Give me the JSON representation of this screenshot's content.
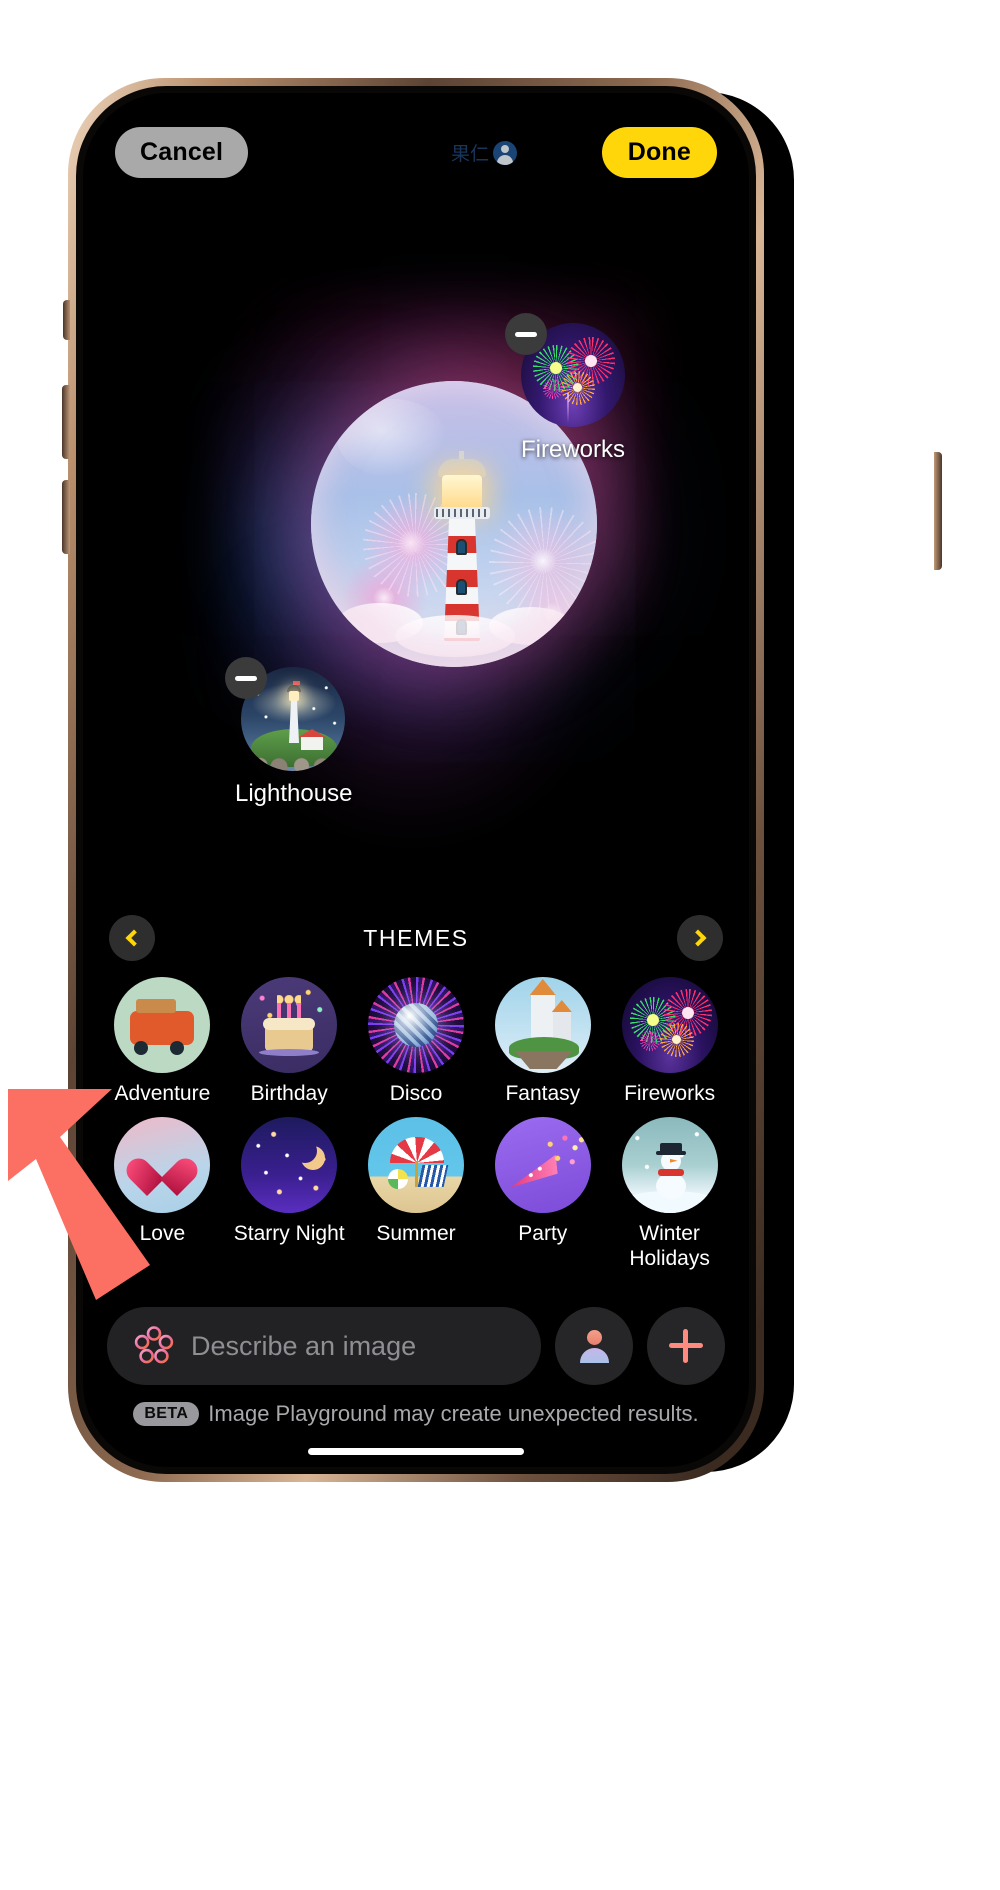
{
  "topbar": {
    "cancel_label": "Cancel",
    "done_label": "Done",
    "watermark_text": "果仁",
    "watermark_icon": "person-avatar-icon"
  },
  "canvas": {
    "artwork_description": "Lighthouse with fireworks inside a glowing bubble",
    "concepts": [
      {
        "label": "Fireworks",
        "icon": "fireworks-thumbnail",
        "remove_icon": "minus-icon"
      },
      {
        "label": "Lighthouse",
        "icon": "lighthouse-thumbnail",
        "remove_icon": "minus-icon"
      }
    ]
  },
  "themes": {
    "title": "THEMES",
    "prev_icon": "chevron-left-icon",
    "next_icon": "chevron-right-icon",
    "accent_color": "#ffd60a",
    "items": [
      {
        "label": "Adventure",
        "icon": "adventure-theme-icon"
      },
      {
        "label": "Birthday",
        "icon": "birthday-theme-icon"
      },
      {
        "label": "Disco",
        "icon": "disco-theme-icon"
      },
      {
        "label": "Fantasy",
        "icon": "fantasy-theme-icon"
      },
      {
        "label": "Fireworks",
        "icon": "fireworks-theme-icon"
      },
      {
        "label": "Love",
        "icon": "love-theme-icon"
      },
      {
        "label": "Starry Night",
        "icon": "starry-night-theme-icon"
      },
      {
        "label": "Summer",
        "icon": "summer-theme-icon"
      },
      {
        "label": "Party",
        "icon": "party-theme-icon"
      },
      {
        "label": "Winter Holidays",
        "icon": "winter-holidays-theme-icon"
      }
    ]
  },
  "bottom": {
    "prompt_value": "",
    "prompt_placeholder": "Describe an image",
    "prompt_icon": "image-playground-icon",
    "person_button_icon": "person-icon",
    "add_button_icon": "plus-icon",
    "beta_badge": "BETA",
    "beta_notice": "Image Playground may create unexpected results."
  },
  "annotation": {
    "arrow_color": "#fc6f63",
    "arrow_target": "describe-an-image-field"
  }
}
